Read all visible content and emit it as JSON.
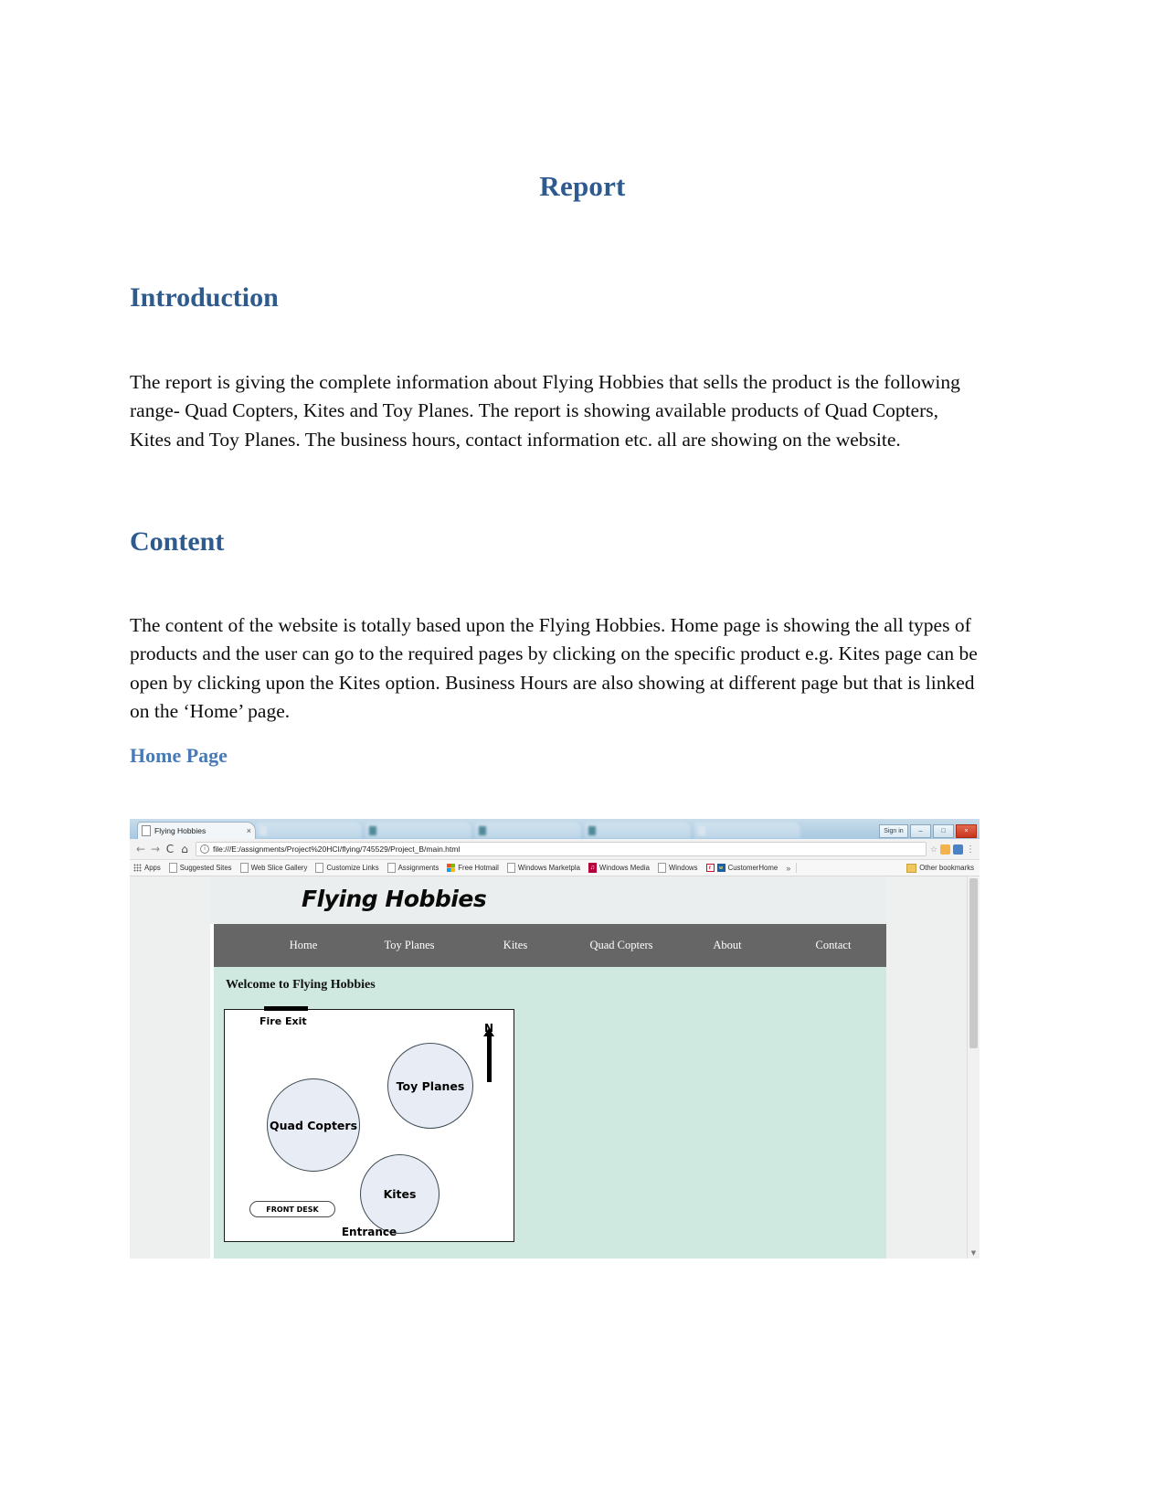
{
  "document": {
    "title": "Report",
    "sections": [
      {
        "heading": "Introduction",
        "body": "The report is giving the complete information about Flying Hobbies that sells the product is the following range- Quad Copters, Kites and Toy Planes. The report is showing available products of Quad Copters, Kites and Toy Planes. The business hours, contact information etc. all are showing on the website."
      },
      {
        "heading": "Content",
        "body": "The content of the website is totally based upon the Flying Hobbies. Home page is showing the all types of products and the user can go to the required pages by clicking on the specific product e.g. Kites page can be open by clicking upon the Kites option. Business Hours are also showing at different page but that is linked on the ‘Home’ page."
      }
    ],
    "subheading": "Home Page"
  },
  "browser": {
    "tabs": {
      "active": {
        "label": "Flying Hobbies",
        "close_label": "×",
        "favicon": "page-icon"
      },
      "background_count": 5
    },
    "window_controls": {
      "signin": "Sign in",
      "minimize": "–",
      "maximize": "□",
      "close": "×"
    },
    "toolbar": {
      "back": "←",
      "forward": "→",
      "reload": "C",
      "home": "⌂",
      "url": "file:///E:/assignments/Project%20HCI/flying/745529/Project_B/main.html",
      "info_icon": "i",
      "bookmark_star": "☆",
      "menu": "⋮"
    },
    "bookmarks": [
      {
        "label": "Apps",
        "icon": "grid-icon"
      },
      {
        "label": "Suggested Sites",
        "icon": "page-icon"
      },
      {
        "label": "Web Slice Gallery",
        "icon": "page-icon"
      },
      {
        "label": "Customize Links",
        "icon": "page-icon"
      },
      {
        "label": "Assignments",
        "icon": "page-icon"
      },
      {
        "label": "Free Hotmail",
        "icon": "microsoft-icon"
      },
      {
        "label": "Windows Marketpla",
        "icon": "page-icon"
      },
      {
        "label": "Windows Media",
        "icon": "media-icon"
      },
      {
        "label": "Windows",
        "icon": "page-icon"
      },
      {
        "label": "CustomerHome",
        "icon": "r-icon"
      }
    ],
    "bookmarks_overflow": "»",
    "other_bookmarks": "Other bookmarks"
  },
  "website": {
    "logo": "Flying Hobbies",
    "nav": [
      "Home",
      "Toy Planes",
      "Kites",
      "Quad Copters",
      "About",
      "Contact"
    ],
    "welcome_heading": "Welcome to Flying Hobbies",
    "floorplan": {
      "fire_exit": "Fire Exit",
      "entrance": "Entrance",
      "front_desk": "FRONT DESK",
      "compass": "N",
      "zones": [
        {
          "name": "Quad Copters"
        },
        {
          "name": "Toy Planes"
        },
        {
          "name": "Kites"
        }
      ]
    }
  },
  "colors": {
    "heading_blue": "#2e5a8e",
    "subheading_blue": "#4a7ab5",
    "nav_bar": "#666666",
    "page_background": "#cfe9e0",
    "circle_fill": "#e8edf5"
  }
}
